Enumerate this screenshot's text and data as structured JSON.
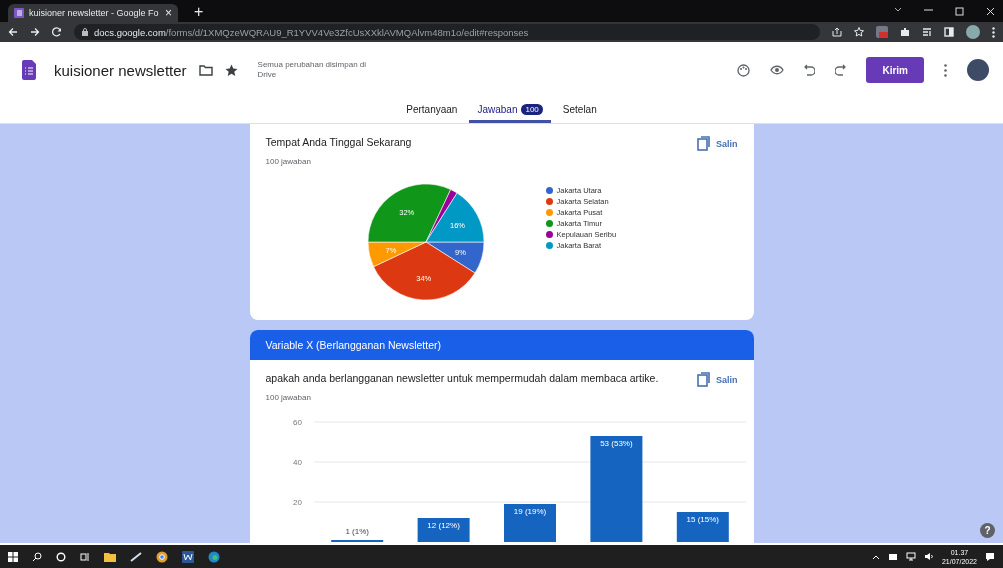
{
  "browser": {
    "tab_title": "kuisioner newsletter - Google Fo",
    "tab_close": "×",
    "new_tab": "+",
    "url_host": "docs.google.com",
    "url_path": "/forms/d/1XMQzeWQRAU9_R1YVV4Ve3ZfcUsXXklAVMQAlvm48m1o/edit#responses"
  },
  "form_header": {
    "title": "kuisioner newsletter",
    "save_status": "Semua perubahan disimpan di Drive",
    "send_button": "Kirim"
  },
  "tabs": [
    {
      "label": "Pertanyaan",
      "selected": false
    },
    {
      "label": "Jawaban",
      "badge": "100",
      "selected": true
    },
    {
      "label": "Setelan",
      "selected": false
    }
  ],
  "summary_cards": [
    {
      "title": "Tempat Anda Tinggal Sekarang",
      "responses": "100 jawaban",
      "copy_label": "Salin",
      "chart_data": {
        "type": "pie",
        "categories": [
          "Jakarta Utara",
          "Jakarta Selatan",
          "Jakarta Pusat",
          "Jakarta Timur",
          "Kepulauan Seribu",
          "Jakarta Barat"
        ],
        "values": [
          9,
          34,
          7,
          32,
          2,
          16
        ],
        "colors": [
          "#3366cc",
          "#dc3912",
          "#ff9900",
          "#109618",
          "#990099",
          "#0099c6"
        ],
        "value_labels": [
          "9%",
          "34%",
          "7%",
          "32%",
          null,
          "16%"
        ]
      }
    },
    {
      "section_title": "Variable X (Berlangganan Newsletter)",
      "title": "apakah anda berlangganan newsletter untuk mempermudah dalam membaca artike.",
      "responses": "100 jawaban",
      "copy_label": "Salin",
      "chart_data": {
        "type": "bar",
        "series": [
          {
            "color": "#1565c0",
            "values": [
              1,
              12,
              19,
              53,
              15
            ]
          }
        ],
        "ylim": [
          0,
          60
        ],
        "yticks": [
          20,
          40,
          60
        ],
        "value_labels": [
          "1 (1%)",
          "12 (12%)",
          "19 (19%)",
          "53 (53%)",
          "15 (15%)"
        ]
      }
    }
  ],
  "help_button": "?",
  "taskbar": {
    "time": "01.37",
    "date": "21/07/2022"
  }
}
